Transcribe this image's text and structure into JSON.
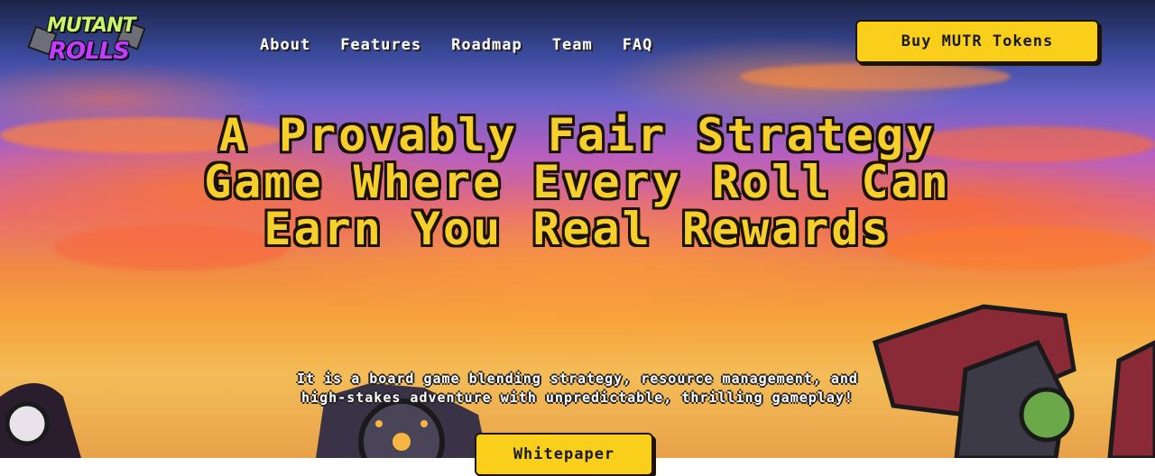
{
  "brand": {
    "logo_line1": "MUTANT",
    "logo_line2": "ROLLS"
  },
  "nav": {
    "links": [
      "About",
      "Features",
      "Roadmap",
      "Team",
      "FAQ"
    ]
  },
  "cta": {
    "buy_label": "Buy MUTR Tokens",
    "whitepaper_label": "Whitepaper"
  },
  "hero": {
    "title": "A Provably Fair Strategy Game Where Every Roll Can Earn You Real Rewards",
    "subtitle_line1": "It is a board game blending strategy, resource management, and",
    "subtitle_line2": "high-stakes adventure with unpredictable, thrilling gameplay!"
  },
  "colors": {
    "accent_yellow": "#f9cf1b",
    "title_yellow": "#f6cf2a",
    "sky_top": "#1b2447",
    "sky_orange": "#f08a45"
  },
  "icons": [
    "dice-icon"
  ]
}
